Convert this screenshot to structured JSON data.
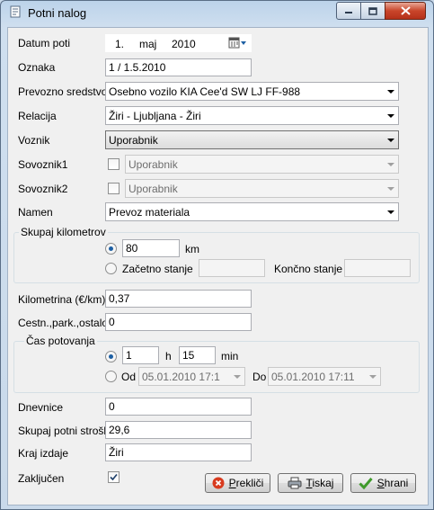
{
  "window": {
    "title": "Potni nalog"
  },
  "form": {
    "datum_poti": {
      "label": "Datum poti",
      "day": "1.",
      "month": "maj",
      "year": "2010"
    },
    "oznaka": {
      "label": "Oznaka",
      "value": "1 / 1.5.2010"
    },
    "prevozno_sredstvo": {
      "label": "Prevozno sredstvo",
      "value": "Osebno vozilo KIA Cee'd SW LJ FF-988"
    },
    "relacija": {
      "label": "Relacija",
      "value": "Žiri - Ljubljana - Žiri"
    },
    "voznik": {
      "label": "Voznik",
      "value": "Uporabnik"
    },
    "sovoznik1": {
      "label": "Sovoznik1",
      "value": "Uporabnik",
      "checked": false
    },
    "sovoznik2": {
      "label": "Sovoznik2",
      "value": "Uporabnik",
      "checked": false
    },
    "namen": {
      "label": "Namen",
      "value": "Prevoz materiala"
    },
    "skupaj_km": {
      "legend": "Skupaj kilometrov",
      "km_value": "80",
      "km_unit": "km",
      "start_label": "Začetno stanje",
      "end_label": "Končno stanje",
      "selected": "km"
    },
    "kilometrina": {
      "label": "Kilometrina (€/km)",
      "value": "0,37"
    },
    "cestnina": {
      "label": "Cestn.,park.,ostalo",
      "value": "0"
    },
    "cas_potovanja": {
      "legend": "Čas potovanja",
      "hours": "1",
      "h_unit": "h",
      "minutes": "15",
      "min_unit": "min",
      "od_label": "Od",
      "od_value": "05.01.2010  17:1",
      "do_label": "Do",
      "do_value": "05.01.2010  17:11",
      "selected": "duration"
    },
    "dnevnice": {
      "label": "Dnevnice",
      "value": "0"
    },
    "skupaj_stroski": {
      "label": "Skupaj potni stroški",
      "value": "29,6"
    },
    "kraj_izdaje": {
      "label": "Kraj izdaje",
      "value": "Žiri"
    },
    "zakljucen": {
      "label": "Zaključen",
      "checked": true
    }
  },
  "buttons": {
    "preklici": {
      "label_u": "P",
      "label_rest": "rekliči"
    },
    "tiskaj": {
      "label_u": "T",
      "label_rest": "iskaj"
    },
    "shrani": {
      "label_u": "S",
      "label_rest": "hrani"
    }
  },
  "colors": {
    "cancel_icon": "#d83b1f",
    "ok_check": "#3f9a2b",
    "radio_dot": "#1d5fa3"
  }
}
